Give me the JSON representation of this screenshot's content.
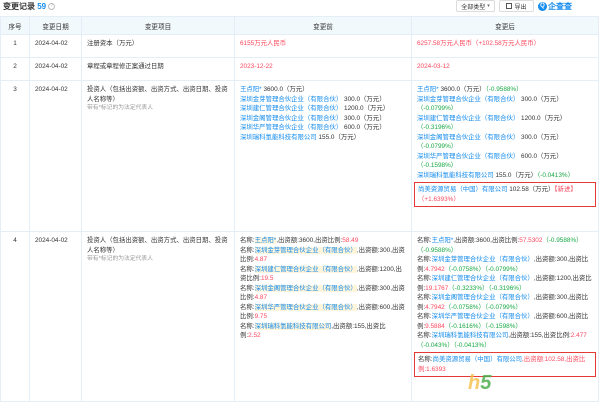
{
  "header": {
    "title": "变更记录",
    "count": "59",
    "filter_label": "全部类型",
    "export_label": "导出",
    "logo_text": "企查查"
  },
  "columns": [
    "序号",
    "变更日期",
    "变更项目",
    "变更前",
    "变更后"
  ],
  "rows": [
    {
      "index": "1",
      "date": "2024-04-02",
      "item": "注册资本（万元）",
      "before": "6155万元人民币",
      "after": "6257.58万元人民币（+102.58万元人民币）"
    },
    {
      "index": "2",
      "date": "2024-04-02",
      "item": "章程或章程修正案通过日期",
      "before": "2023-12-22",
      "after": "2024-03-12"
    },
    {
      "index": "3",
      "date": "2024-04-02",
      "item": "投资人（包括出资额、出资方式、出资日期、投资人名称等）",
      "item_hint": "带有*标记的为法定代表人",
      "before": [
        {
          "name": "王点阳*",
          "rest": " 3600.0（万元）"
        },
        {
          "name": "深圳金芽管理合伙企业（有限合伙）",
          "rest": " 300.0（万元）"
        },
        {
          "name": "深圳建仁管理合伙企业（有限合伙）",
          "rest": " 1200.0（万元）"
        },
        {
          "name": "深圳金阁管理合伙企业（有限合伙）",
          "rest": " 300.0（万元）"
        },
        {
          "name": "深圳华严管理合伙企业（有限合伙）",
          "rest": " 600.0（万元）"
        },
        {
          "name": "深圳瑞科氢能科技有限公司",
          "rest": " 155.0（万元）"
        }
      ],
      "after": [
        {
          "name": "王点阳*",
          "rest": " 3600.0（万元）",
          "delta": "（-0.9588%）"
        },
        {
          "name": "深圳金芽管理合伙企业（有限合伙）",
          "rest": " 300.0（万元）",
          "delta": "（-0.0799%）"
        },
        {
          "name": "深圳建仁管理合伙企业（有限合伙）",
          "rest": " 1200.0（万元）",
          "delta": "（-0.3196%）"
        },
        {
          "name": "深圳金阁管理合伙企业（有限合伙）",
          "rest": " 300.0（万元）",
          "delta": "（-0.0799%）"
        },
        {
          "name": "深圳华严管理合伙企业（有限合伙）",
          "rest": " 600.0（万元）",
          "delta": "（-0.1598%）"
        },
        {
          "name": "深圳瑞科氢能科技有限公司",
          "rest": " 155.0（万元）",
          "delta": "（-0.0413%）"
        }
      ],
      "after_new": {
        "name": "尚美资源贸易（中国）有限公司",
        "rest": " 102.58（万元）",
        "tag": "【新进】",
        "delta": "（+1.6393%）"
      }
    },
    {
      "index": "4",
      "date": "2024-04-02",
      "item": "投资人（包括出资额、出资方式、出资日期、投资人名称等）",
      "item_hint": "带有*标记的为法定代表人",
      "before": [
        {
          "prefix": "名称:",
          "name": "王点阳*",
          "mid": ",出资额:3600,出资比例:",
          "ratio": "58.49"
        },
        {
          "prefix": "名称:",
          "name": "深圳金芽管理合伙企业（有限合伙）",
          "mid": ",出资额:300,出资比例:",
          "ratio": "4.87"
        },
        {
          "prefix": "名称:",
          "name": "深圳建仁管理合伙企业（有限合伙）",
          "mid": ",出资额:1200,出资比例:",
          "ratio": "19.5"
        },
        {
          "prefix": "名称:",
          "name": "深圳金阁管理合伙企业（有限合伙）",
          "mid": ",出资额:300,出资比例:",
          "ratio": "4.87"
        },
        {
          "prefix": "名称:",
          "name": "深圳华严管理合伙企业（有限合伙）",
          "mid": ",出资额:600,出资比例:",
          "ratio": "9.75"
        },
        {
          "prefix": "名称:",
          "name": "深圳瑞科氢能科技有限公司",
          "mid": ",出资额:155,出资比例:",
          "ratio": "2.52"
        }
      ],
      "after": [
        {
          "prefix": "名称:",
          "name": "王点阳*",
          "mid": ",出资额:3600,出资比例:",
          "ratio": "57.5302",
          "rdelta": "（-0.9588%）",
          "delta": "（-0.9588%）"
        },
        {
          "prefix": "名称:",
          "name": "深圳金芽管理合伙企业（有限合伙）",
          "mid": ",出资额:300,出资比例:",
          "ratio": "4.7942",
          "rdelta": "（-0.0758%）",
          "delta": "（-0.0799%）"
        },
        {
          "prefix": "名称:",
          "name": "深圳建仁管理合伙企业（有限合伙）",
          "mid": ",出资额:1200,出资比例:",
          "ratio": "19.1767",
          "rdelta": "（-0.3233%）",
          "delta": "（-0.3196%）"
        },
        {
          "prefix": "名称:",
          "name": "深圳金阁管理合伙企业（有限合伙）",
          "mid": ",出资额:300,出资比例:",
          "ratio": "4.7942",
          "rdelta": "（-0.0758%）",
          "delta": "（-0.0799%）"
        },
        {
          "prefix": "名称:",
          "name": "深圳华严管理合伙企业（有限合伙）",
          "mid": ",出资额:600,出资比例:",
          "ratio": "9.5884",
          "rdelta": "（-0.1616%）",
          "delta": "（-0.1598%）"
        },
        {
          "prefix": "名称:",
          "name": "深圳瑞科氢能科技有限公司",
          "mid": ",出资额:155,出资比例:",
          "ratio": "2.477",
          "rdelta": "（-0.043%）",
          "delta": "（-0.0413%）"
        }
      ],
      "after_new": {
        "prefix": "名称:",
        "name": "尚美资源贸易（中国）有限公司",
        "mid": ",出资额:102.58,出资比例:",
        "ratio": "1.6393"
      }
    }
  ],
  "colors": {
    "accent": "#128bed",
    "increase": "#fd485e",
    "decrease": "#17a843",
    "header_bg": "#f2f9fc",
    "highlight_box": "#e53935"
  }
}
